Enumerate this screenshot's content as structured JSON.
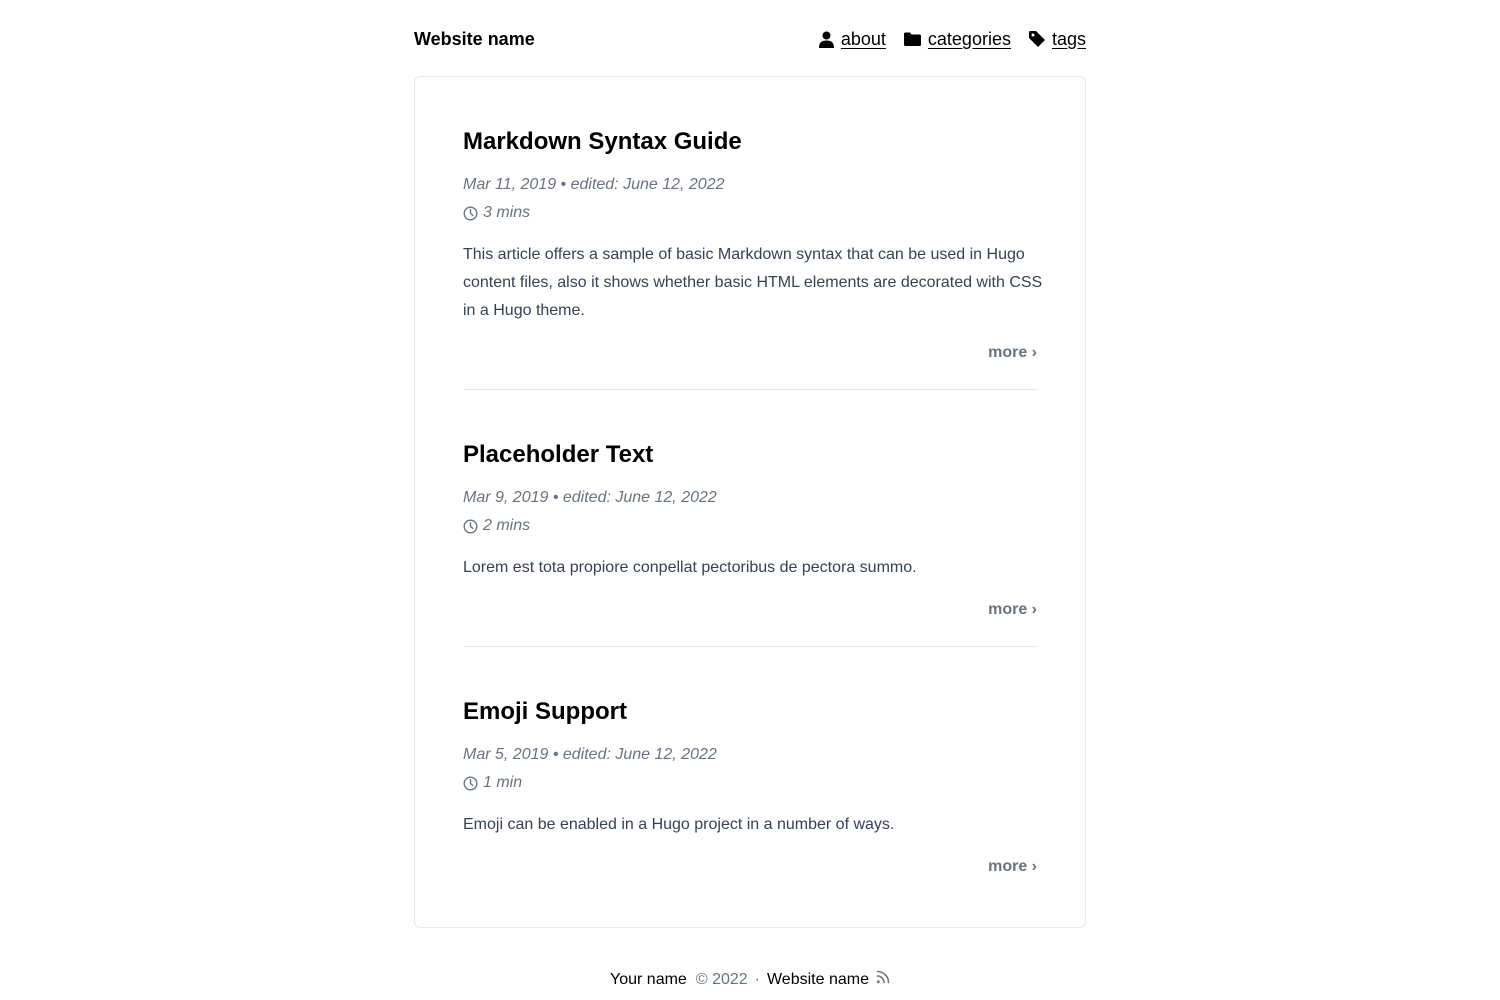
{
  "header": {
    "site_name": "Website name",
    "nav": [
      {
        "label": "about",
        "icon": "user-icon"
      },
      {
        "label": "categories",
        "icon": "folder-icon"
      },
      {
        "label": "tags",
        "icon": "tag-icon"
      }
    ]
  },
  "posts": [
    {
      "title": "Markdown Syntax Guide",
      "date": "Mar 11, 2019 • edited: June 12, 2022",
      "read_time": "3 mins",
      "summary": "This article offers a sample of basic Markdown syntax that can be used in Hugo content files, also it shows whether basic HTML elements are decorated with CSS in a Hugo theme.",
      "more_label": "more ›"
    },
    {
      "title": "Placeholder Text",
      "date": "Mar 9, 2019 • edited: June 12, 2022",
      "read_time": "2 mins",
      "summary": "Lorem est tota propiore conpellat pectoribus de pectora summo.",
      "more_label": "more ›"
    },
    {
      "title": "Emoji Support",
      "date": "Mar 5, 2019 • edited: June 12, 2022",
      "read_time": "1 min",
      "summary": "Emoji can be enabled in a Hugo project in a number of ways.",
      "more_label": "more ›"
    }
  ],
  "footer": {
    "author": "Your name",
    "copyright": "© 2022",
    "separator": "·",
    "site_name": "Website name",
    "rss_icon": "rss-icon"
  },
  "colors": {
    "text": "#000000",
    "muted": "#6b7280",
    "body": "#374151",
    "border": "#e5e7eb"
  }
}
